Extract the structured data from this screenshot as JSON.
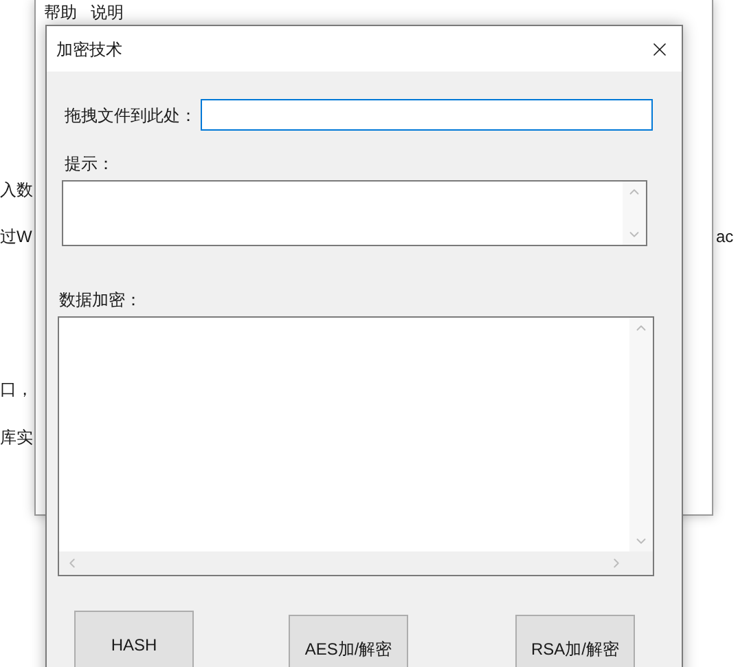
{
  "desktop": {
    "left_fragments": [
      "入数",
      "过W",
      "口，",
      "库实"
    ],
    "right_fragments": [
      "ac"
    ]
  },
  "background_window": {
    "menu": [
      "帮助",
      "说明"
    ]
  },
  "dialog": {
    "title": "加密技术",
    "file_field": {
      "label": "拖拽文件到此处：",
      "focused": true
    },
    "hint": {
      "label": "提示："
    },
    "data": {
      "label": "数据加密："
    },
    "buttons": [
      "HASH",
      "AES加/解密",
      "RSA加/解密"
    ]
  }
}
